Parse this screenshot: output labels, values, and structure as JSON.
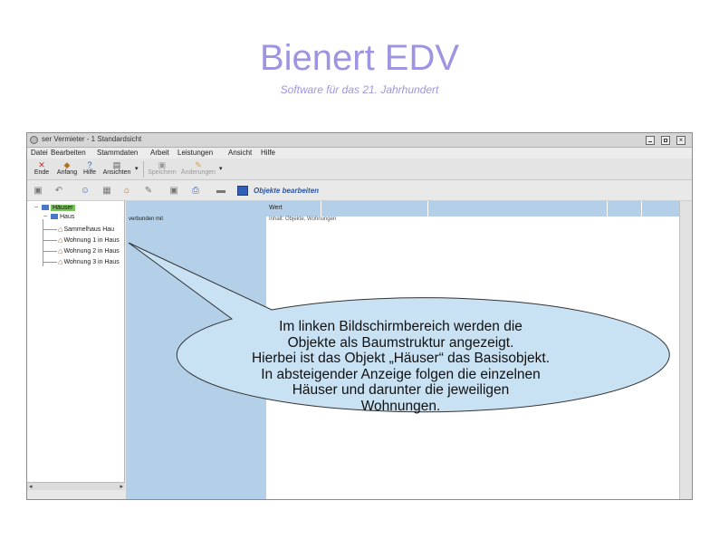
{
  "slide": {
    "title": "Bienert EDV",
    "subtitle": "Software für das 21. Jahrhundert"
  },
  "window": {
    "title": "ser Vermieter - 1 Standardsicht",
    "close_glyph": "×"
  },
  "menu": [
    "Datei",
    "Bearbeiten",
    "Stammdaten",
    "Arbeit",
    "Leistungen",
    "Ansicht",
    "Hilfe"
  ],
  "toolbar": {
    "buttons": [
      {
        "label": "Ende",
        "icon": "✕"
      },
      {
        "label": "Anfang",
        "icon": "◆"
      },
      {
        "label": "Hilfe",
        "icon": "?"
      },
      {
        "label": "Ansichten",
        "icon": "▤"
      },
      {
        "label": "Speichern",
        "icon": "▣"
      },
      {
        "label": "Änderungen",
        "icon": "✎"
      }
    ],
    "dropdown_glyph": "▾"
  },
  "toolbar2": {
    "icons": [
      "▣",
      "↶",
      "☺",
      "▦",
      "⌂",
      "✎",
      "▣",
      "⎙",
      "▬"
    ],
    "object_edit_label": "Objekte bearbeiten"
  },
  "tree": {
    "root": {
      "label": "Häuser",
      "toggle": "−"
    },
    "group": {
      "label": "Haus",
      "toggle": "−"
    },
    "items": [
      "Sammelhaus Hau",
      "Wohnung 1 in Haus",
      "Wohnung 2 in Haus",
      "Wohnung 3 in Haus"
    ],
    "house_glyph": "⌂",
    "scroll_left": "◂",
    "scroll_right": "▸"
  },
  "grid": {
    "header_value": "Wert",
    "row_key": "verbunden mit",
    "row_value": "Inhalt: Objekte, Wohnungen"
  },
  "callout_lines": [
    "Im linken Bildschirmbereich werden die",
    "Objekte als Baumstruktur angezeigt.",
    "Hierbei ist das Objekt „Häuser“ das Basisobjekt.",
    "In absteigender Anzeige folgen die einzelnen",
    "Häuser und darunter die jeweiligen",
    "Wohnungen."
  ],
  "colors": {
    "title": "#9d95e0",
    "callout_fill": "#c9e2f3",
    "grid_blue": "#b3d0e8",
    "selection_green": "#7ac35a"
  }
}
